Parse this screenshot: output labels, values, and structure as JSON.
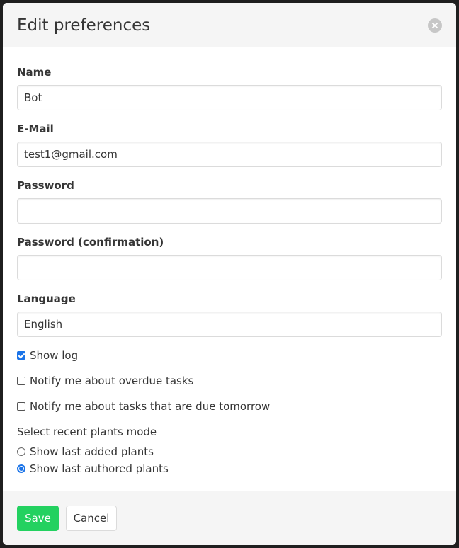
{
  "modal": {
    "title": "Edit preferences"
  },
  "form": {
    "name": {
      "label": "Name",
      "value": "Bot"
    },
    "email": {
      "label": "E-Mail",
      "value": "test1@gmail.com"
    },
    "password": {
      "label": "Password",
      "value": ""
    },
    "password_confirmation": {
      "label": "Password (confirmation)",
      "value": ""
    },
    "language": {
      "label": "Language",
      "selected": "English"
    },
    "checkboxes": [
      {
        "label": "Show log",
        "checked": true
      },
      {
        "label": "Notify me about overdue tasks",
        "checked": false
      },
      {
        "label": "Notify me about tasks that are due tomorrow",
        "checked": false
      }
    ],
    "recent_plants": {
      "label": "Select recent plants mode",
      "options": [
        {
          "label": "Show last added plants",
          "selected": false
        },
        {
          "label": "Show last authored plants",
          "selected": true
        }
      ]
    }
  },
  "footer": {
    "save_label": "Save",
    "cancel_label": "Cancel"
  },
  "colors": {
    "primary": "#23d160",
    "accent": "#1a73e8",
    "header_bg": "#f5f5f5"
  }
}
